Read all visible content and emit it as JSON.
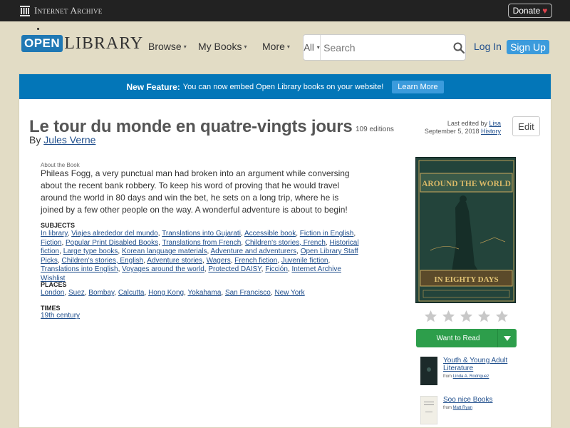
{
  "ia_bar": {
    "logo_text": "Internet Archive",
    "donate_label": "Donate",
    "donate_heart": "♥"
  },
  "header": {
    "logo_open": "OPEN",
    "logo_library": "LIBRARY",
    "nav": [
      {
        "label": "Browse"
      },
      {
        "label": "My Books"
      },
      {
        "label": "More"
      }
    ],
    "search": {
      "scope": "All",
      "placeholder": "Search"
    },
    "login_label": "Log In",
    "signup_label": "Sign Up"
  },
  "banner": {
    "strong": "New Feature:",
    "text": "You can now embed Open Library books on your website!",
    "button": "Learn More"
  },
  "book": {
    "title": "Le tour du monde en quatre-vingts jours",
    "editions": "109 editions",
    "by_label": "By",
    "author": "Jules Verne",
    "last_edited_label": "Last edited by",
    "last_edited_user": "Lisa",
    "last_edited_date": "September 5, 2018",
    "history_label": "History",
    "edit_label": "Edit",
    "about_label": "About the Book",
    "description": "Phileas Fogg, a very punctual man had broken into an argument while conversing about the recent bank robbery. To keep his word of proving that he would travel around the world in 80 days and win the bet, he sets on a long trip, where he is joined by a few other people on the way. A wonderful adventure is about to begin!"
  },
  "subjects": {
    "label": "SUBJECTS",
    "items": [
      "In library",
      "Viajes alrededor del mundo",
      "Translations into Gujarati",
      "Accessible book",
      "Fiction in English",
      "Fiction",
      "Popular Print Disabled Books",
      "Translations from French",
      "Children's stories, French",
      "Historical fiction",
      "Large type books",
      "Korean language materials",
      "Adventure and adventurers",
      "Open Library Staff Picks",
      "Children's stories, English",
      "Adventure stories",
      "Wagers",
      "French fiction",
      "Juvenile fiction",
      "Translations into English",
      "Voyages around the world",
      "Protected DAISY",
      "Ficción",
      "Internet Archive Wishlist"
    ]
  },
  "places": {
    "label": "PLACES",
    "items": [
      "London",
      "Suez",
      "Bombay",
      "Calcutta",
      "Hong Kong",
      "Yokahama",
      "San Francisco",
      "New York"
    ]
  },
  "times": {
    "label": "TIMES",
    "items": [
      "19th century"
    ]
  },
  "cover": {
    "line1": "AROUND THE WORLD",
    "line2": "IN EIGHTY DAYS"
  },
  "rating": {
    "stars": 5,
    "filled": 0
  },
  "want_to_read": {
    "label": "Want to Read"
  },
  "lists": [
    {
      "title": "Youth & Young Adult Literature",
      "from_label": "from",
      "owner": "Linda A. Rodriguez"
    },
    {
      "title": "Soo nice Books",
      "from_label": "from",
      "owner": "Matt Ryan"
    }
  ],
  "colors": {
    "accent_blue": "#0376b8",
    "link_blue": "#1f4e8c",
    "green": "#2d9e4b",
    "background": "#e2dcc5"
  }
}
